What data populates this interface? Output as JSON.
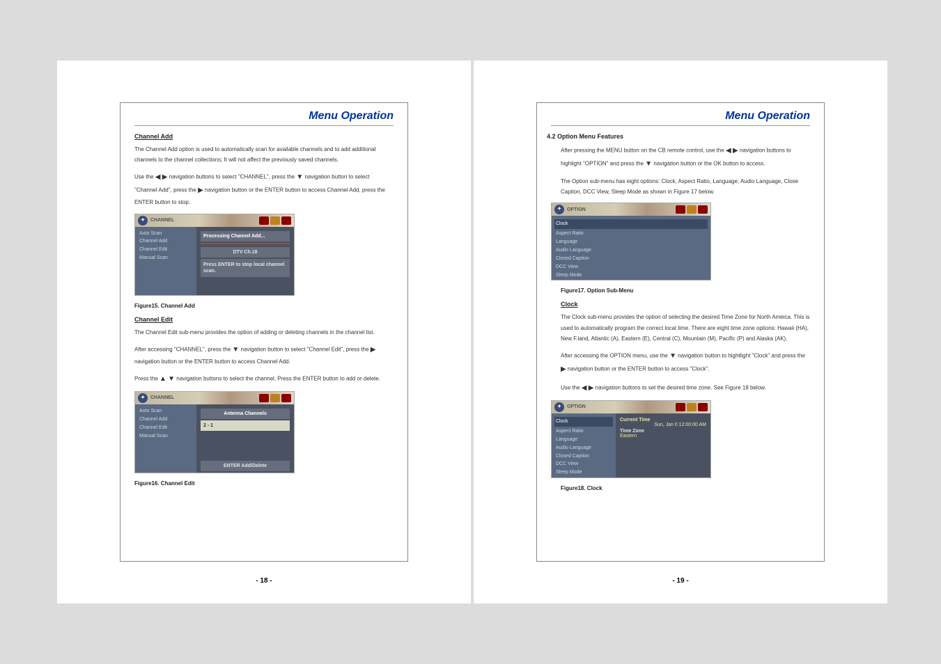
{
  "page18": {
    "header": "Menu Operation",
    "channel_add": {
      "title": "Channel Add",
      "p1": "The Channel Add option is used to automatically scan for available channels and to add additional channels to the channel collections; It will not affect the previously saved channels.",
      "p2a": "Use the ",
      "p2b": " navigation buttons to select \"CHANNEL\", press the ",
      "p2c": " navigation button to select \"Channel Add\", press the ",
      "p2d": " navigation button or the ENTER button to access Channel Add, press the ENTER button to stop.",
      "menu": {
        "tab": "CHANNEL",
        "items": [
          "Auto Scan",
          "Channel Add",
          "Channel Edit",
          "Manual Scan"
        ],
        "r1": "Processing Channel Add...",
        "r2": "DTV Ch.18",
        "r3": "Press ENTER to stop local channel scan."
      },
      "caption": "Figure15. Channel Add"
    },
    "channel_edit": {
      "title": "Channel Edit",
      "p1": "The Channel Edit sub-menu provides the option of adding or deleting channels in the channel list.",
      "p2a": "After accessing \"CHANNEL\", press the ",
      "p2b": " navigation button to select \"Channel Edit\", press the ",
      "p2c": " navigation button or the ENTER button to access Channel Add.",
      "p3a": "Press the ",
      "p3b": " navigation buttons to select the channel, Press the ENTER button to add or delete.",
      "menu": {
        "tab": "CHANNEL",
        "items": [
          "Auto Scan",
          "Channel Add",
          "Channel Edit",
          "Manual Scan"
        ],
        "r1": "Antenna Channels",
        "r2": "2 - 1",
        "footer": "ENTER  Add/Delete"
      },
      "caption": "Figure16. Channel Edit"
    },
    "pagenum": "- 18 -"
  },
  "page19": {
    "header": "Menu Operation",
    "option_menu": {
      "heading": "4.2 Option Menu Features",
      "p1a": "After pressing the MENU button on the CB remote control, use the ",
      "p1b": " navigation buttons to highlight \"OPTION\" and press the ",
      "p1c": " navigation button or the OK button to access.",
      "p2": "The Option sub-menu has eight options: Clock, Aspect Ratio, Language, Audio Language, Close Capiton, DCC View, Sleep Mode as shown in Figure 17 below.",
      "menu": {
        "tab": "OPTION",
        "items": [
          "Clock",
          "Aspect Ratio",
          "Language",
          "Audio Language",
          "Closed Caption",
          "DCC View",
          "Sleep Mode"
        ]
      },
      "caption": "Figure17. Option Sub-Menu"
    },
    "clock": {
      "title": "Clock",
      "p1": "The Clock sub-menu provides the option of selecting the desired Time Zone for North Ameica. This is used to automatically program the correct local time.  There are eight time zone options: Hawaii (HA), New F.land, Atlantic (A), Eastern (E), Central (C), Mountain (M), Pacific (P) and Alaska (AK).",
      "p2a": "After accessing the OPTION menu, use the ",
      "p2b": " navigation button to hightlight \"Clock\" and press the ",
      "p2c": " navigation button or the ENTER button to access \"Clock\".",
      "p3a": "Use the ",
      "p3b": " navigation buttons to set the desired time zone. See Figure 18 below.",
      "menu": {
        "tab": "OPTION",
        "items": [
          "Clock",
          "Aspect Ratio",
          "Language",
          "Audio Language",
          "Closed Caption",
          "DCC View",
          "Sleep Mode"
        ],
        "r_labels": [
          "Current Time",
          "Time Zone"
        ],
        "r_vals": [
          "Sun, Jan 0    12:00:00 AM",
          "Eastern"
        ]
      },
      "caption": "Figure18. Clock"
    },
    "pagenum": "- 19 -"
  }
}
